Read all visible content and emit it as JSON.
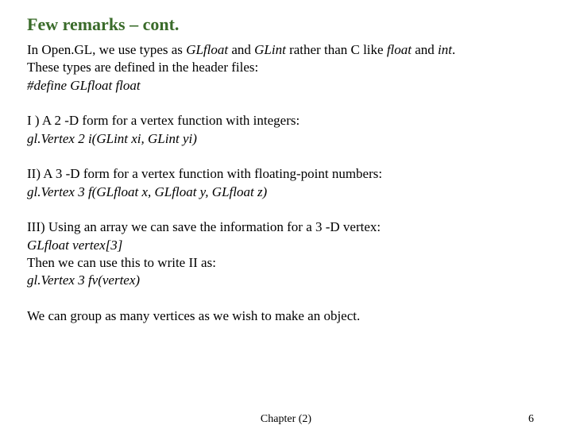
{
  "title": "Few remarks – cont.",
  "p1": {
    "l1a": "In Open.GL, we use types as ",
    "l1b": "GLfloat",
    "l1c": " and ",
    "l1d": "GLint",
    "l1e": " rather than C like ",
    "l1f": "float",
    "l1g": " and ",
    "l1h": "int",
    "l1i": ".",
    "l2": "These types are defined in the header files:",
    "l3": "#define GLfloat float"
  },
  "p2": {
    "l1": "I ) A 2 -D form for a vertex function with integers:",
    "l2": "gl.Vertex 2 i(GLint  xi, GLint yi)"
  },
  "p3": {
    "l1": "II) A 3 -D form  for a vertex function with floating-point numbers:",
    "l2": "gl.Vertex 3 f(GLfloat x, GLfloat y, GLfloat z)"
  },
  "p4": {
    "l1": "III) Using an array we can save the information for a 3 -D vertex:",
    "l2": "GLfloat vertex[3]",
    "l3": "Then we can use this to write II as:",
    "l4": "gl.Vertex 3 fv(vertex)"
  },
  "p5": "We can group as many vertices as we wish to make an object.",
  "footer": {
    "center": "Chapter (2)",
    "page": "6"
  }
}
